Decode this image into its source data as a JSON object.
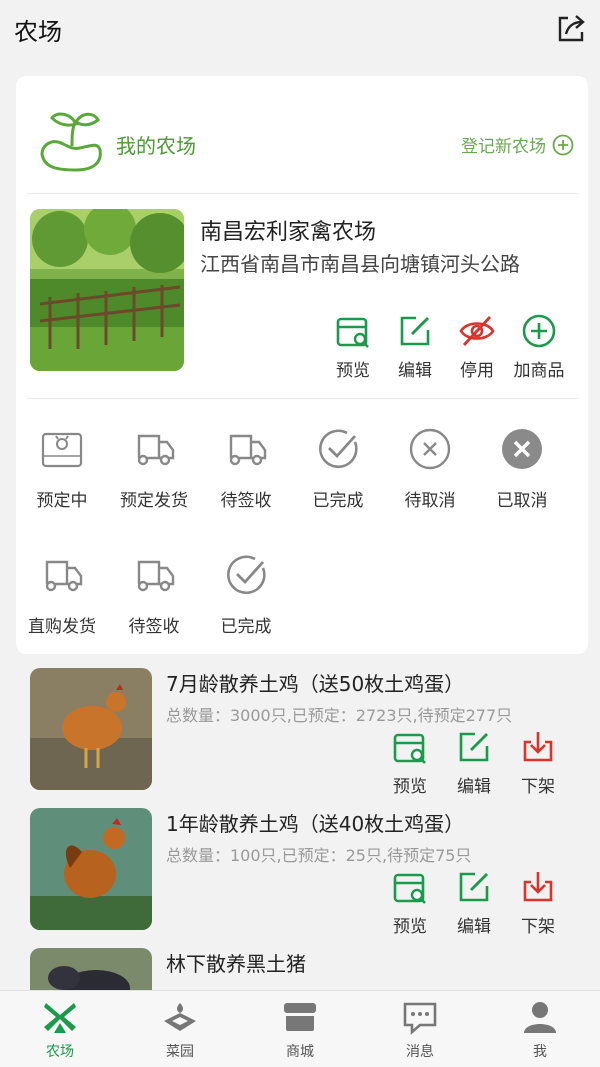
{
  "header": {
    "title": "农场",
    "share_icon": "share-icon"
  },
  "farm_card": {
    "title": "我的农场",
    "register_label": "登记新农场",
    "farm": {
      "name": "南昌宏利家禽农场",
      "address": "江西省南昌市南昌县向塘镇河头公路",
      "actions": [
        {
          "label": "预览",
          "icon": "preview-icon",
          "color": "#1a9a4a"
        },
        {
          "label": "编辑",
          "icon": "edit-icon",
          "color": "#1a9a4a"
        },
        {
          "label": "停用",
          "icon": "eye-off-icon",
          "color": "#d9342b"
        },
        {
          "label": "加商品",
          "icon": "add-circle-icon",
          "color": "#1a9a4a"
        }
      ]
    },
    "order_status": [
      {
        "label": "预定中",
        "icon": "home-reserve-icon"
      },
      {
        "label": "预定发货",
        "icon": "truck-icon"
      },
      {
        "label": "待签收",
        "icon": "truck-icon"
      },
      {
        "label": "已完成",
        "icon": "check-circle-icon"
      },
      {
        "label": "待取消",
        "icon": "x-circle-outline-icon"
      },
      {
        "label": "已取消",
        "icon": "x-circle-filled-icon"
      }
    ],
    "direct_status": [
      {
        "label": "直购发货",
        "icon": "truck-icon"
      },
      {
        "label": "待签收",
        "icon": "truck-icon"
      },
      {
        "label": "已完成",
        "icon": "check-circle-icon"
      }
    ]
  },
  "products": [
    {
      "name": "7月龄散养土鸡（送50枚土鸡蛋）",
      "info": "总数量：3000只,已预定：2723只,待预定277只",
      "actions": [
        {
          "label": "预览",
          "icon": "preview-icon"
        },
        {
          "label": "编辑",
          "icon": "edit-icon"
        },
        {
          "label": "下架",
          "icon": "download-icon"
        }
      ]
    },
    {
      "name": "1年龄散养土鸡（送40枚土鸡蛋）",
      "info": "总数量：100只,已预定：25只,待预定75只",
      "actions": [
        {
          "label": "预览",
          "icon": "preview-icon"
        },
        {
          "label": "编辑",
          "icon": "edit-icon"
        },
        {
          "label": "下架",
          "icon": "download-icon"
        }
      ]
    },
    {
      "name": "林下散养黑土猪"
    }
  ],
  "tabbar": [
    {
      "label": "农场",
      "icon": "windmill-icon",
      "active": true
    },
    {
      "label": "菜园",
      "icon": "garden-icon",
      "active": false
    },
    {
      "label": "商城",
      "icon": "store-icon",
      "active": false
    },
    {
      "label": "消息",
      "icon": "message-icon",
      "active": false
    },
    {
      "label": "我",
      "icon": "user-icon",
      "active": false
    }
  ]
}
